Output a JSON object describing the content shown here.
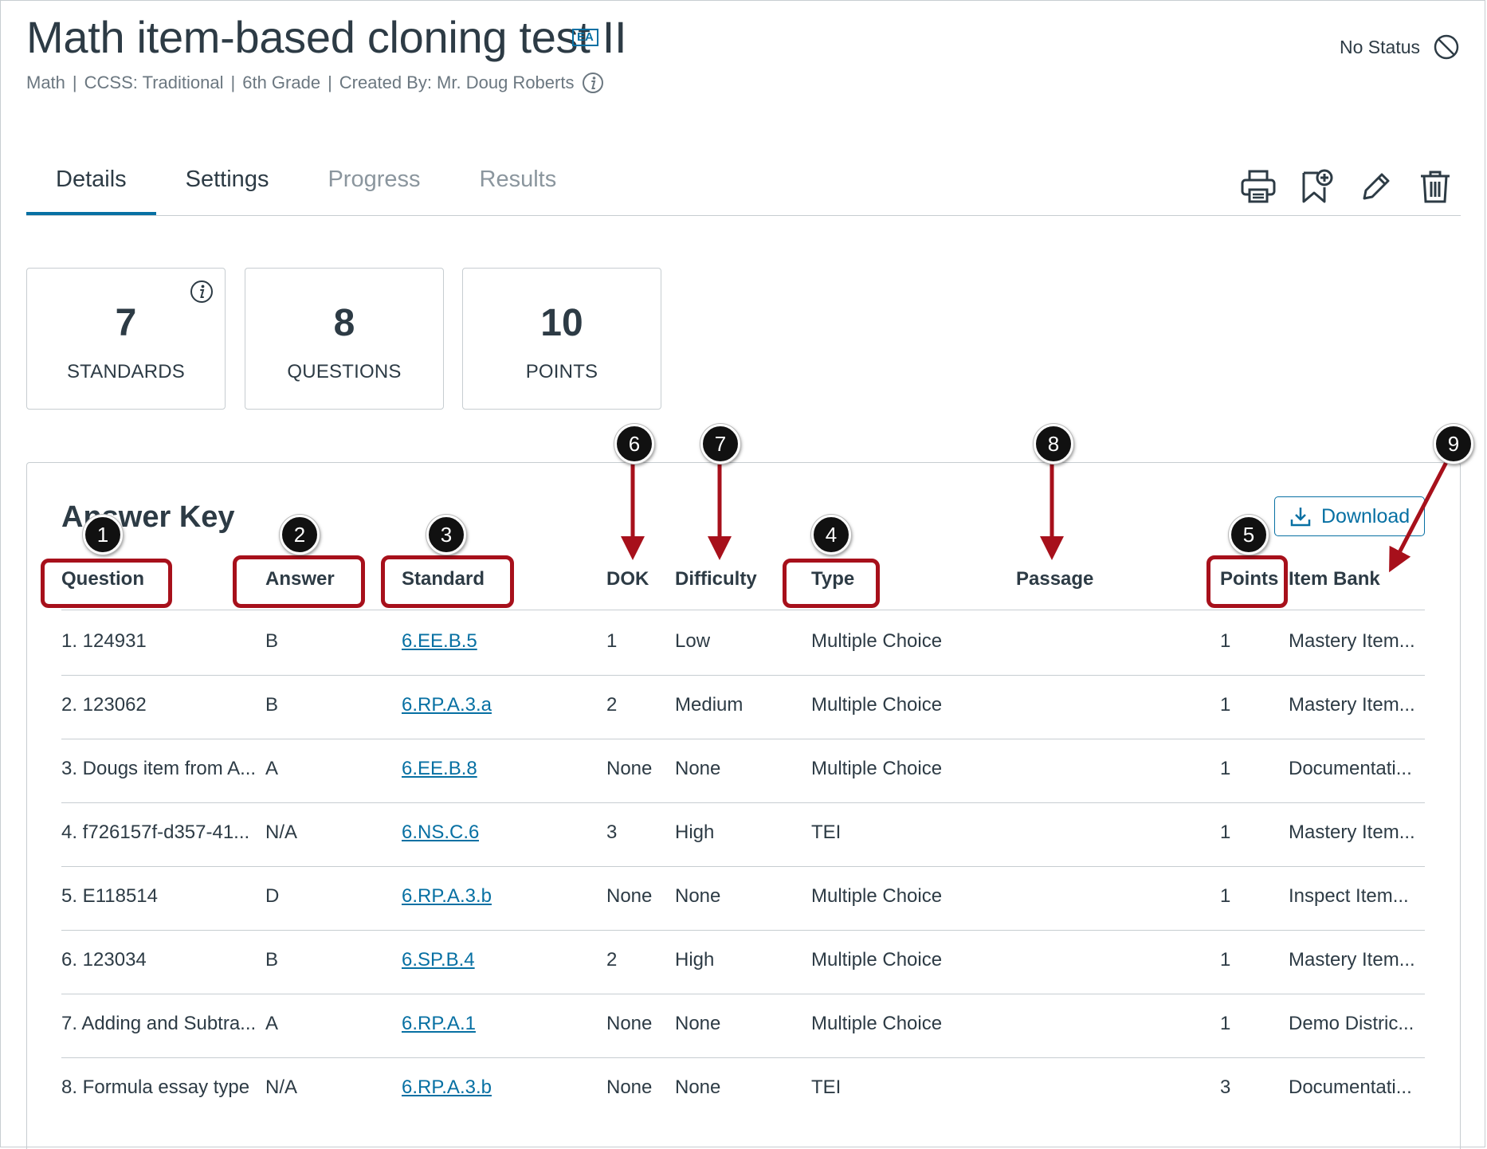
{
  "header": {
    "title": "Math item-based cloning test II",
    "title_badge": "EA",
    "meta": [
      "Math",
      "CCSS: Traditional",
      "6th Grade",
      "Created By: Mr. Doug Roberts"
    ],
    "status_label": "No Status"
  },
  "tabs": [
    {
      "label": "Details",
      "state": "active"
    },
    {
      "label": "Settings",
      "state": "enabled"
    },
    {
      "label": "Progress",
      "state": "disabled"
    },
    {
      "label": "Results",
      "state": "disabled"
    }
  ],
  "toolbar": {
    "icons": [
      "print-icon",
      "bookmark-add-icon",
      "edit-pencil-icon",
      "trash-icon"
    ]
  },
  "stats": [
    {
      "value": "7",
      "label": "STANDARDS"
    },
    {
      "value": "8",
      "label": "QUESTIONS"
    },
    {
      "value": "10",
      "label": "POINTS"
    }
  ],
  "answer_key": {
    "title": "Answer Key",
    "download_label": "Download",
    "columns": [
      "Question",
      "Answer",
      "Standard",
      "DOK",
      "Difficulty",
      "Type",
      "Passage",
      "Points",
      "Item Bank"
    ],
    "rows": [
      {
        "question": "1. 124931",
        "answer": "B",
        "standard": "6.EE.B.5",
        "dok": "1",
        "difficulty": "Low",
        "type": "Multiple Choice",
        "passage": "",
        "points": "1",
        "item_bank": "Mastery Item..."
      },
      {
        "question": "2. 123062",
        "answer": "B",
        "standard": "6.RP.A.3.a",
        "dok": "2",
        "difficulty": "Medium",
        "type": "Multiple Choice",
        "passage": "",
        "points": "1",
        "item_bank": "Mastery Item..."
      },
      {
        "question": "3. Dougs item from A...",
        "answer": "A",
        "standard": "6.EE.B.8",
        "dok": "None",
        "difficulty": "None",
        "type": "Multiple Choice",
        "passage": "",
        "points": "1",
        "item_bank": "Documentati..."
      },
      {
        "question": "4. f726157f-d357-41...",
        "answer": "N/A",
        "standard": "6.NS.C.6",
        "dok": "3",
        "difficulty": "High",
        "type": "TEI",
        "passage": "",
        "points": "1",
        "item_bank": "Mastery Item..."
      },
      {
        "question": "5. E118514",
        "answer": "D",
        "standard": "6.RP.A.3.b",
        "dok": "None",
        "difficulty": "None",
        "type": "Multiple Choice",
        "passage": "",
        "points": "1",
        "item_bank": "Inspect Item..."
      },
      {
        "question": "6. 123034",
        "answer": "B",
        "standard": "6.SP.B.4",
        "dok": "2",
        "difficulty": "High",
        "type": "Multiple Choice",
        "passage": "",
        "points": "1",
        "item_bank": "Mastery Item..."
      },
      {
        "question": "7. Adding and Subtra...",
        "answer": "A",
        "standard": "6.RP.A.1",
        "dok": "None",
        "difficulty": "None",
        "type": "Multiple Choice",
        "passage": "",
        "points": "1",
        "item_bank": "Demo Distric..."
      },
      {
        "question": "8. Formula essay type",
        "answer": "N/A",
        "standard": "6.RP.A.3.b",
        "dok": "None",
        "difficulty": "None",
        "type": "TEI",
        "passage": "",
        "points": "3",
        "item_bank": "Documentati..."
      }
    ]
  },
  "annotations": {
    "badges": [
      "1",
      "2",
      "3",
      "4",
      "5",
      "6",
      "7",
      "8",
      "9"
    ],
    "color": "#a7101b"
  },
  "colors": {
    "accent": "#0770a3",
    "text": "#2d3b45",
    "muted": "#6b7780",
    "annotation": "#a7101b"
  }
}
